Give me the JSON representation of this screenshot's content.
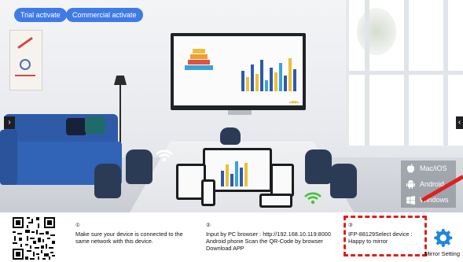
{
  "header": {
    "trial_button": "Trial activate",
    "commercial_button": "Commercial activate"
  },
  "platforms": [
    {
      "label": "Mac/iOS",
      "icon": "apple-icon"
    },
    {
      "label": "Android",
      "icon": "android-icon"
    },
    {
      "label": "Windows",
      "icon": "windows-icon"
    }
  ],
  "steps": [
    {
      "number": "①",
      "text": "Make sure your device is connected to the same network with this device."
    },
    {
      "number": "②",
      "text": "Input by PC browser : http://192.168.10.119:8000 Android phone Scan the QR-Code by browser Download APP"
    },
    {
      "number": "③",
      "text": "IFP-88129Select device : Happy to mirror"
    }
  ],
  "settings": {
    "label": "Mirror Setting",
    "icon": "gear-icon"
  },
  "nav": {
    "left_arrow": "›",
    "right_arrow": "‹"
  },
  "colors": {
    "accent": "#3f7be6",
    "highlight": "#e0201b",
    "gear": "#1f86e0"
  }
}
